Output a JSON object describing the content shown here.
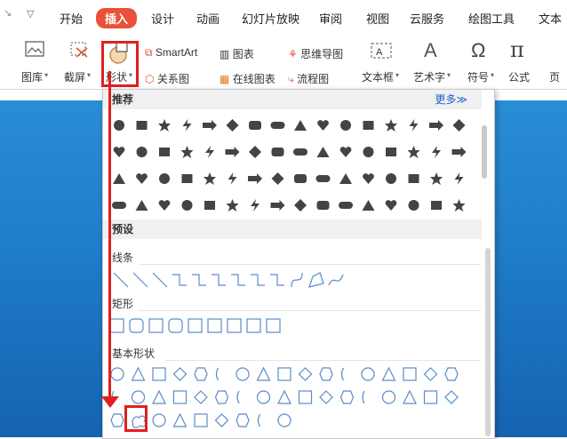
{
  "tabs": [
    {
      "label": "开始"
    },
    {
      "label": "插入"
    },
    {
      "label": "设计"
    },
    {
      "label": "动画"
    },
    {
      "label": "幻灯片放映"
    },
    {
      "label": "审阅"
    },
    {
      "label": "视图"
    },
    {
      "label": "云服务"
    },
    {
      "label": "绘图工具"
    },
    {
      "label": "文本"
    }
  ],
  "toolbar": {
    "gallery": "图库",
    "screenshot": "截屏",
    "shapes": "形状",
    "smartart": "SmartArt",
    "chart": "图表",
    "mindmap": "思维导图",
    "relation": "关系图",
    "online_chart": "在线图表",
    "flowchart": "流程图",
    "textbox": "文本框",
    "wordart": "艺术字",
    "symbol": "符号",
    "formula": "公式",
    "page": "页"
  },
  "panel": {
    "recommended": "推荐",
    "more": "更多≫",
    "preset": "预设",
    "lines": "线条",
    "rectangles": "矩形",
    "basic_shapes": "基本形状"
  },
  "colors": {
    "accent": "#e8523a",
    "highlight": "#e02020",
    "shape_gray": "#444444",
    "outline_blue": "#5a8cc8",
    "slide_blue": "#1f7dc9"
  }
}
